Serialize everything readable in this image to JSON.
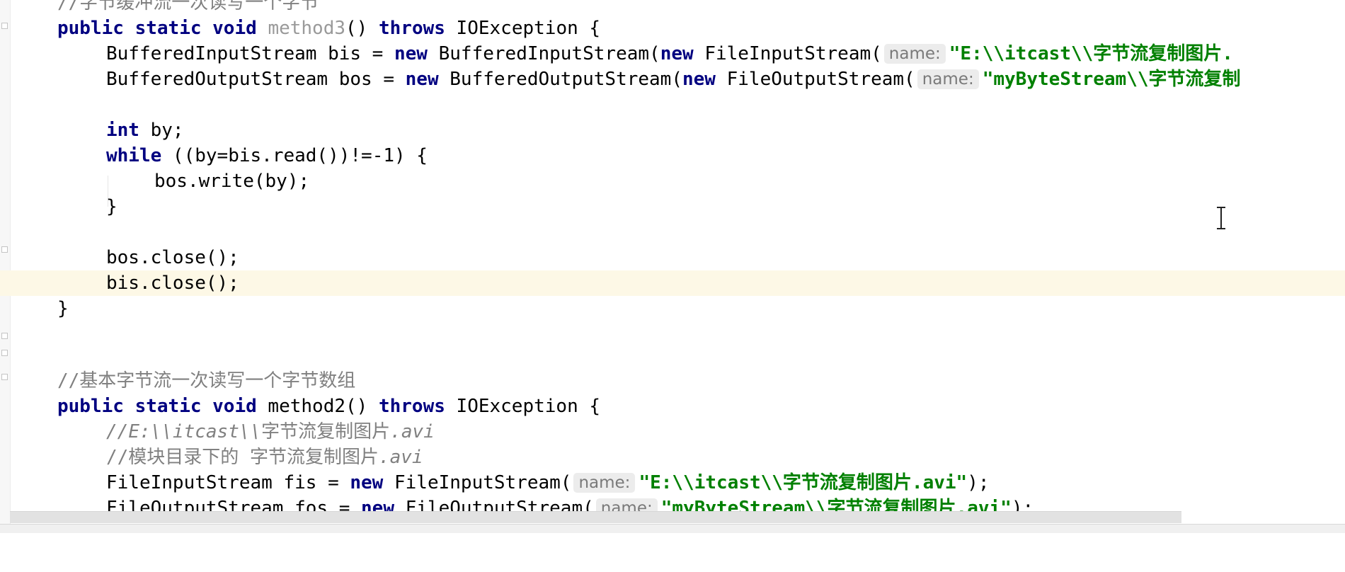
{
  "editor": {
    "lines": {
      "l0": {
        "comment": "//字节缓冲流一次读写一个字节"
      },
      "l1": {
        "kw1": "public",
        "kw2": "static",
        "kw3": "void",
        "method": "method3",
        "rest": "() ",
        "kw4": "throws",
        "ex": " IOException {"
      },
      "l2": {
        "pre": "BufferedInputStream bis = ",
        "kw_new1": "new",
        "mid": " BufferedInputStream(",
        "kw_new2": "new",
        "mid2": " FileInputStream(",
        "hint": "name:",
        "str": "\"E:\\\\itcast\\\\字节流复制图片."
      },
      "l3": {
        "pre": "BufferedOutputStream bos = ",
        "kw_new1": "new",
        "mid": " BufferedOutputStream(",
        "kw_new2": "new",
        "mid2": " FileOutputStream(",
        "hint": "name:",
        "str": "\"myByteStream\\\\字节流复制"
      },
      "l5": {
        "kw": "int",
        "rest": " by;"
      },
      "l6": {
        "kw": "while",
        "rest": " ((by=bis.read())!=-1) {"
      },
      "l7": {
        "text": "bos.write(by);"
      },
      "l8": {
        "text": "}"
      },
      "l10": {
        "text": "bos.close();"
      },
      "l11": {
        "text": "bis.close();"
      },
      "l12": {
        "text": "}"
      },
      "l15": {
        "comment": "//基本字节流一次读写一个字节数组"
      },
      "l16": {
        "kw1": "public",
        "kw2": "static",
        "kw3": "void",
        "method": " method2() ",
        "kw4": "throws",
        "ex": " IOException {"
      },
      "l17": {
        "comment_a": "//",
        "comment_b": "E:\\\\itcast\\\\",
        "comment_c": "字节流复制图片",
        "comment_d": ".avi"
      },
      "l18": {
        "comment_a": "//模块目录下的 字节流复制图片",
        "comment_d": ".avi"
      },
      "l19": {
        "pre": "FileInputStream fis = ",
        "kw_new": "new",
        "mid": " FileInputStream(",
        "hint": "name:",
        "str": "\"E:\\\\itcast\\\\字节流复制图片.avi\"",
        "end": ");"
      },
      "l20": {
        "pre": "FileOutputStream fos = ",
        "kw_new": "new",
        "mid": " FileOutputStream(",
        "hint": "name:",
        "str": "\"myByteStream\\\\字节流复制图片.avi\"",
        "end": ");"
      }
    }
  }
}
